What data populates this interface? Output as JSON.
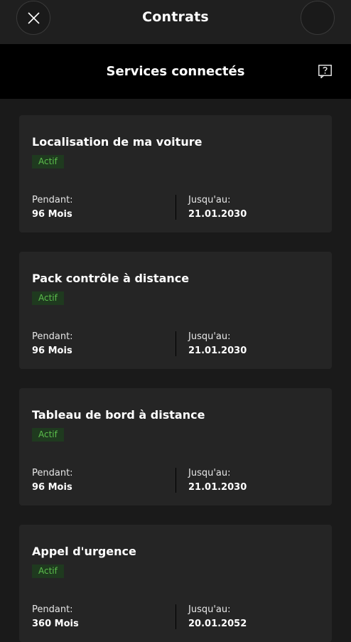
{
  "header": {
    "title": "Contrats"
  },
  "section": {
    "title": "Services connectés",
    "help_icon": "question-box-icon"
  },
  "contracts": [
    {
      "name": "Localisation de ma voiture",
      "status": "Actif",
      "duration_label": "Pendant:",
      "duration_value": "96 Mois",
      "end_label": "Jusqu'au:",
      "end_value": "21.01.2030"
    },
    {
      "name": "Pack contrôle à distance",
      "status": "Actif",
      "duration_label": "Pendant:",
      "duration_value": "96 Mois",
      "end_label": "Jusqu'au:",
      "end_value": "21.01.2030"
    },
    {
      "name": "Tableau de bord à distance",
      "status": "Actif",
      "duration_label": "Pendant:",
      "duration_value": "96 Mois",
      "end_label": "Jusqu'au:",
      "end_value": "21.01.2030"
    },
    {
      "name": "Appel d'urgence",
      "status": "Actif",
      "duration_label": "Pendant:",
      "duration_value": "360 Mois",
      "end_label": "Jusqu'au:",
      "end_value": "20.01.2052"
    }
  ],
  "colors": {
    "background": "#1a1a1a",
    "card": "#252525",
    "section_header": "#000000",
    "status_active_text": "#5cbf4c",
    "status_active_bg": "#1f3a1f"
  }
}
